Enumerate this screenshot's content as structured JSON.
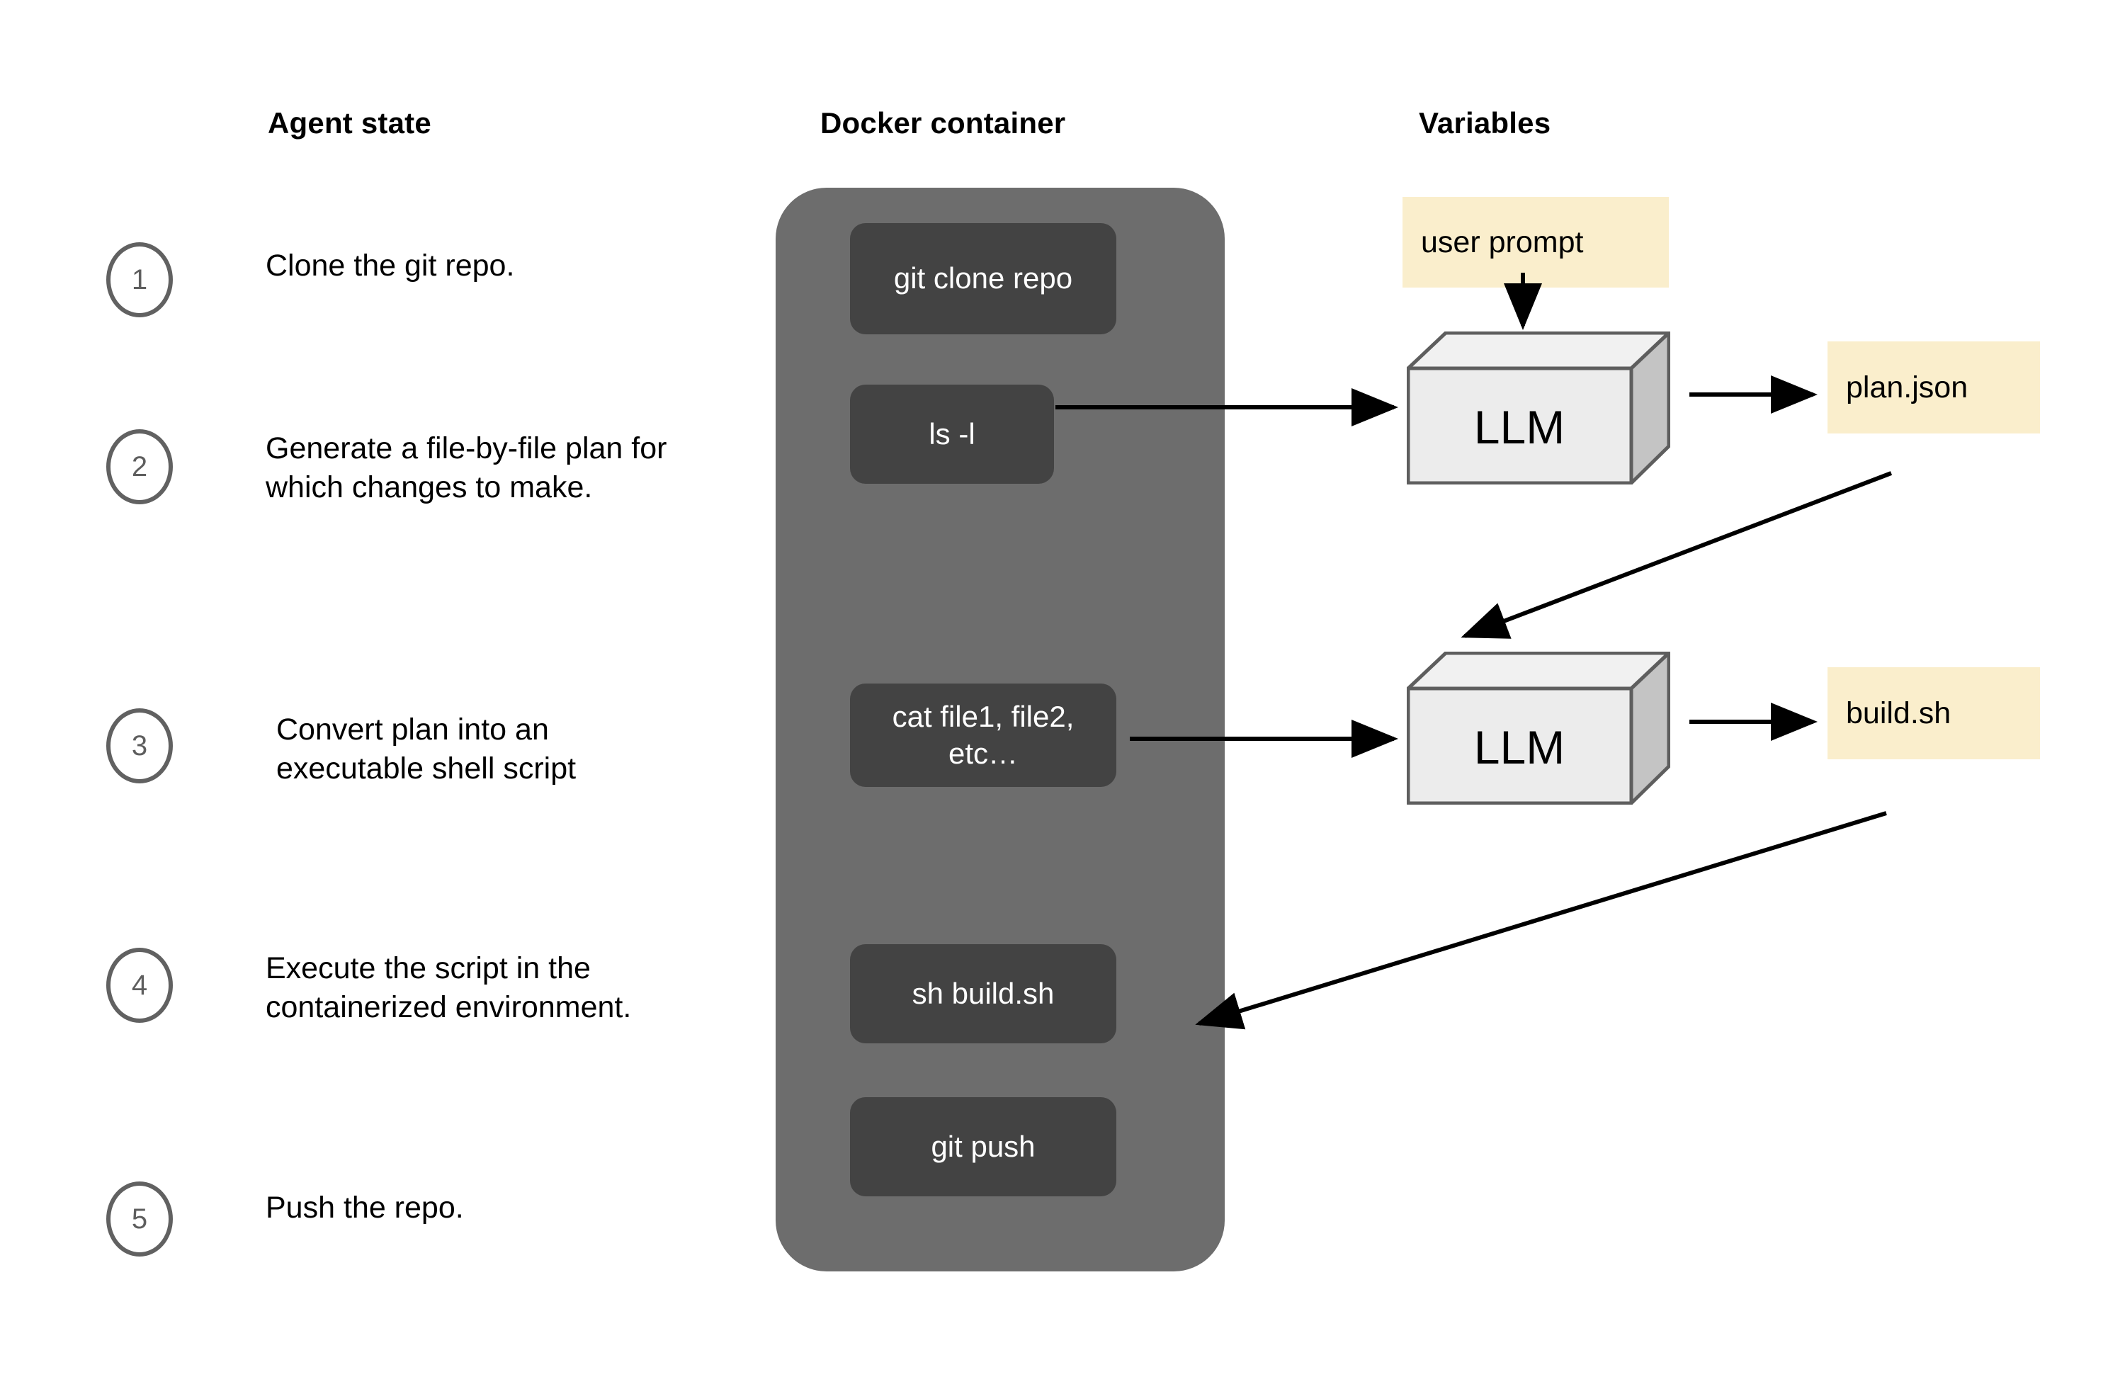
{
  "columns": {
    "agent_state": "Agent state",
    "docker_container": "Docker container",
    "variables": "Variables"
  },
  "steps": [
    {
      "number": "1",
      "text": "Clone the git repo."
    },
    {
      "number": "2",
      "text": "Generate a file-by-file plan for which changes to make."
    },
    {
      "number": "3",
      "text": "Convert plan into an executable shell script"
    },
    {
      "number": "4",
      "text": "Execute the script in the containerized environment."
    },
    {
      "number": "5",
      "text": "Push the repo."
    }
  ],
  "commands": [
    {
      "label": "git clone repo"
    },
    {
      "label": "ls -l"
    },
    {
      "label": "cat file1, file2, etc…"
    },
    {
      "label": "sh build.sh"
    },
    {
      "label": "git push"
    }
  ],
  "variables": [
    {
      "label": "user prompt"
    },
    {
      "label": "plan.json"
    },
    {
      "label": "build.sh"
    }
  ],
  "llms": [
    {
      "label": "LLM"
    },
    {
      "label": "LLM"
    }
  ],
  "colors": {
    "container_fill": "#6d6d6d",
    "command_fill": "#434343",
    "command_text": "#ffffff",
    "variable_fill": "#faeecc",
    "cube_front": "#ececec",
    "cube_top": "#f1f1f1",
    "cube_side": "#c4c4c4",
    "cube_stroke": "#5e5e5e",
    "circle_stroke": "#616161",
    "arrow": "#000000",
    "background": "#ffffff"
  }
}
